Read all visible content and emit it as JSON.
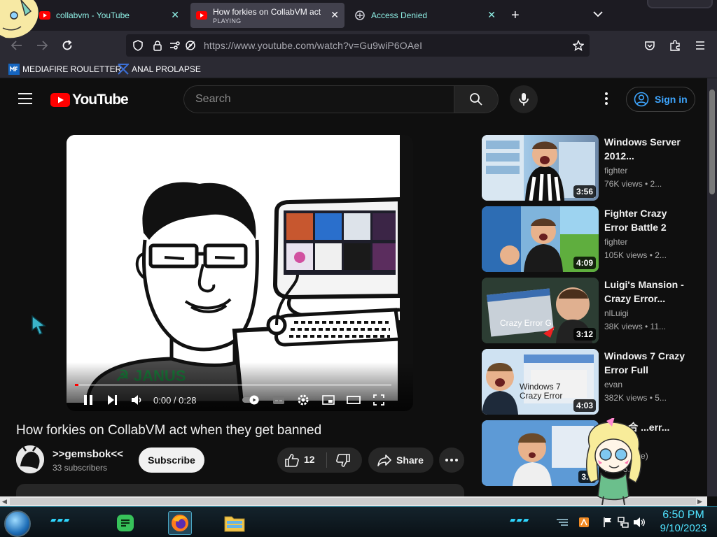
{
  "browser": {
    "tabs": [
      {
        "title": "collabvm - YouTube",
        "subtitle": "",
        "active": false,
        "favicon": "youtube-icon"
      },
      {
        "title": "How forkies on CollabVM act when they get banned",
        "subtitle": "PLAYING",
        "active": true,
        "favicon": "youtube-icon"
      },
      {
        "title": "Access Denied",
        "subtitle": "",
        "active": false,
        "favicon": "site-icon"
      }
    ],
    "new_tab_label": "+",
    "url": "https://www.youtube.com/watch?v=Gu9wiP6OAeI",
    "bookmarks": [
      {
        "label": "MEDIAFIRE ROULETTER",
        "icon": "mediafire-icon"
      },
      {
        "label": "ANAL PROLAPSE",
        "icon": "bookmark-icon"
      }
    ]
  },
  "youtube": {
    "logo_text": "YouTube",
    "search_placeholder": "Search",
    "sign_in_label": "Sign in",
    "player": {
      "time": "0:00 / 0:28",
      "progress_fraction": 0.0
    },
    "video": {
      "title": "How forkies on CollabVM act when they get banned",
      "channel": ">>gemsbok<<",
      "subscribers": "33 subscribers",
      "subscribe_label": "Subscribe",
      "likes": "12",
      "share_label": "Share"
    },
    "related": [
      {
        "title": "Windows Server 2012...",
        "channel": "fighter",
        "views": "76K views • 2...",
        "duration": "3:56"
      },
      {
        "title": "Fighter Crazy Error Battle 2",
        "channel": "fighter",
        "views": "105K views • 2...",
        "duration": "4:09"
      },
      {
        "title": "Luigi's Mansion - Crazy Error...",
        "channel": "nlLuigi",
        "views": "38K views • 11...",
        "duration": "3:12"
      },
      {
        "title": "Windows 7 Crazy Error Full",
        "channel": "evan",
        "views": "382K views • 5...",
        "duration": "4:03"
      },
      {
        "title": "...ws 合 ...err...",
        "channel": "...han!(Cze)",
        "views": "...s • 3...",
        "duration": "3..."
      }
    ]
  },
  "taskbar": {
    "time": "6:50 PM",
    "date": "9/10/2023"
  },
  "colors": {
    "youtube_red": "#ff0000",
    "link_blue": "#3ea6ff",
    "tab_text": "#8ff0e6",
    "clock": "#4fe3ff"
  }
}
